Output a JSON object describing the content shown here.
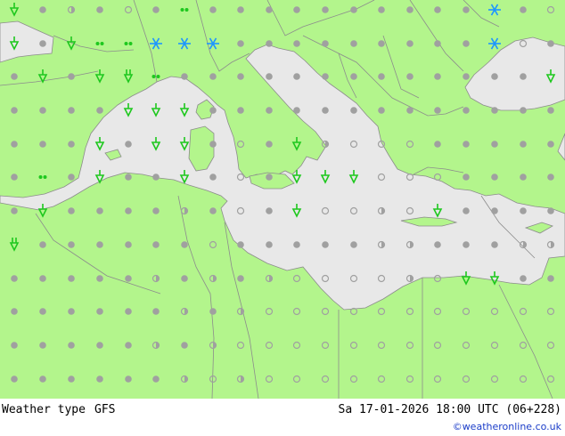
{
  "footer": {
    "title": "Weather type",
    "model": "GFS",
    "datetime": "Sa 17-01-2026 18:00 UTC (06+228)",
    "credit": "©weatheronline.co.uk"
  },
  "colors": {
    "land": "#b3f58c",
    "sea": "#e8e8e8",
    "border": "#8c8c8c",
    "dot": "#a0a0a0",
    "rain": "#1ec81e",
    "snow": "#1e96ff"
  },
  "icons": {
    "dot": "cloudy-dot-icon",
    "half": "partly-cloudy-icon",
    "sun": "clear-sky-icon",
    "rain": "rain-shower-icon",
    "drizzle": "drizzle-icon",
    "heavy": "heavy-rain-icon",
    "snow": "snow-icon"
  }
}
